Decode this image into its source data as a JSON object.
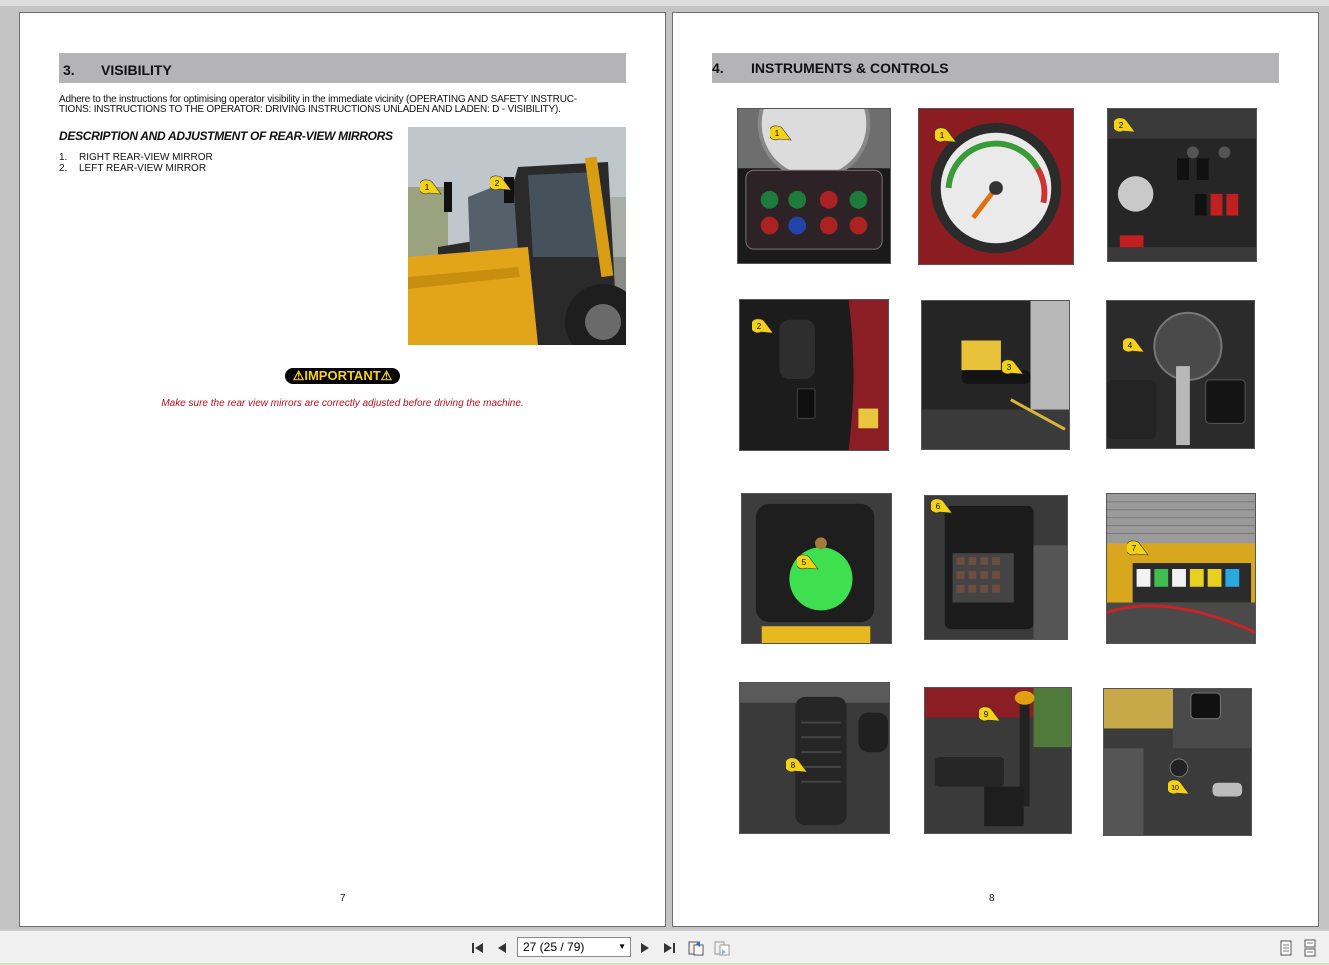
{
  "left_page": {
    "section_number": "3.",
    "section_title": "VISIBILITY",
    "intro_line1": "Adhere to the instructions for optimising operator visibility in the immediate vicinity (OPERATING AND SAFETY INSTRUC-",
    "intro_line2": "TIONS: INSTRUCTIONS TO THE OPERATOR: DRIVING INSTRUCTIONS UNLADEN AND LADEN: D - VISIBILITY).",
    "subheading": "DESCRIPTION AND ADJUSTMENT OF REAR-VIEW MIRRORS",
    "list": [
      {
        "num": "1.",
        "text": "RIGHT REAR-VIEW MIRROR"
      },
      {
        "num": "2.",
        "text": "LEFT REAR-VIEW MIRROR"
      }
    ],
    "photo_markers": [
      "1",
      "2"
    ],
    "important_label": "⚠IMPORTANT⚠",
    "warning_text": "Make sure the rear view mirrors are correctly adjusted before driving the machine.",
    "page_number": "7"
  },
  "right_page": {
    "section_number": "4.",
    "section_title": "INSTRUMENTS & CONTROLS",
    "page_number": "8",
    "thumbnails": [
      {
        "marker": "1",
        "caption_icon": "indicator-panel"
      },
      {
        "marker": "1",
        "caption_icon": "gauge"
      },
      {
        "marker": "2",
        "caption_icon": "dashboard-switches"
      },
      {
        "marker": "2",
        "caption_icon": "side-console"
      },
      {
        "marker": "3",
        "caption_icon": "column-lever"
      },
      {
        "marker": "4",
        "caption_icon": "ignition-key"
      },
      {
        "marker": "5",
        "caption_icon": "fuel-cap"
      },
      {
        "marker": "6",
        "caption_icon": "fuse-box"
      },
      {
        "marker": "7",
        "caption_icon": "battery-fuses"
      },
      {
        "marker": "8",
        "caption_icon": "accelerator-pedal"
      },
      {
        "marker": "9",
        "caption_icon": "gear-lever"
      },
      {
        "marker": "10",
        "caption_icon": "rear-control"
      }
    ]
  },
  "toolbar": {
    "page_display": "27 (25 / 79)",
    "icons": [
      "first-page-icon",
      "prev-page-icon",
      "next-page-icon",
      "last-page-icon",
      "back-view-icon",
      "forward-view-icon",
      "single-page-icon",
      "continuous-page-icon"
    ]
  },
  "colors": {
    "section_bar": "#b4b4b6",
    "badge_bg": "#000000",
    "badge_text": "#f7d21e",
    "warning_red": "#b5121b",
    "marker_yellow": "#f2d117"
  }
}
